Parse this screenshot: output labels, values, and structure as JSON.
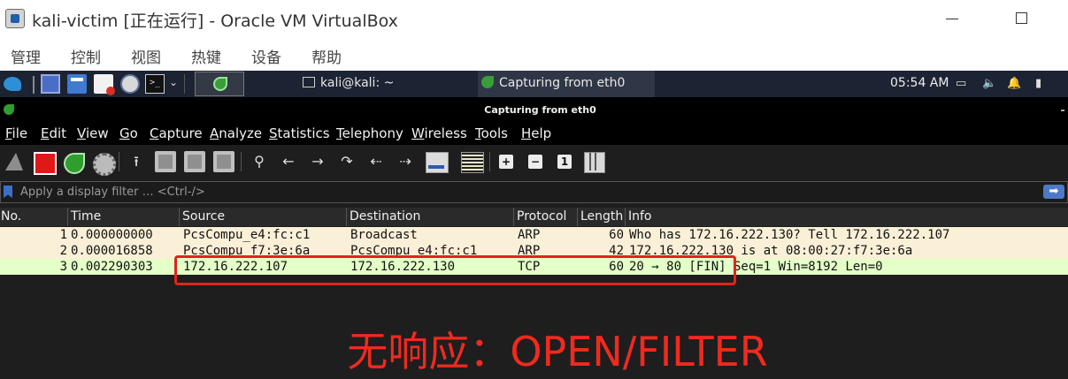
{
  "host_window": {
    "title": "kali-victim [正在运行] - Oracle VM VirtualBox",
    "menu": [
      "管理",
      "控制",
      "视图",
      "热键",
      "设备",
      "帮助"
    ]
  },
  "kali_panel": {
    "tasks": [
      "kali@kali: ~",
      "Capturing from eth0"
    ],
    "clock": "05:54 AM"
  },
  "wireshark": {
    "title": "Capturing from eth0",
    "menu": [
      "File",
      "Edit",
      "View",
      "Go",
      "Capture",
      "Analyze",
      "Statistics",
      "Telephony",
      "Wireless",
      "Tools",
      "Help"
    ],
    "filter_placeholder": "Apply a display filter … <Ctrl-/>",
    "columns": [
      "No.",
      "Time",
      "Source",
      "Destination",
      "Protocol",
      "Length",
      "Info"
    ],
    "packets": [
      {
        "no": "1",
        "time": "0.000000000",
        "source": "PcsCompu_e4:fc:c1",
        "destination": "Broadcast",
        "protocol": "ARP",
        "length": "60",
        "info": "Who has 172.16.222.130? Tell 172.16.222.107",
        "bg": "#faf0d7"
      },
      {
        "no": "2",
        "time": "0.000016858",
        "source": "PcsCompu_f7:3e:6a",
        "destination": "PcsCompu_e4:fc:c1",
        "protocol": "ARP",
        "length": "42",
        "info": "172.16.222.130 is at 08:00:27:f7:3e:6a",
        "bg": "#faf0d7"
      },
      {
        "no": "3",
        "time": "0.002290303",
        "source": "172.16.222.107",
        "destination": "172.16.222.130",
        "protocol": "TCP",
        "length": "60",
        "info": "20 → 80 [FIN] Seq=1 Win=8192 Len=0",
        "bg": "#e4ffc7"
      }
    ]
  },
  "annotation": {
    "text": "无响应：OPEN/FILTER",
    "color": "#f02a1e"
  }
}
